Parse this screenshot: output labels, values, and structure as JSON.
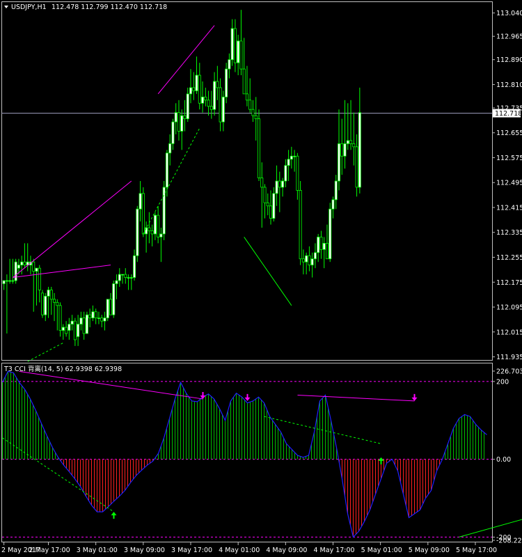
{
  "header": {
    "symbol": "USDJPY,H1",
    "ohlc": "112.478 112.799 112.470 112.718"
  },
  "indicator": {
    "label": "T3 CCI 背离(14, 5) 62.9398 62.9398"
  },
  "colors": {
    "background": "#000000",
    "grid": "#c0c0c0",
    "bull_candle": "#00ff00",
    "bull_body": "#ffffff",
    "bear_candle": "#00ff00",
    "bear_body": "#000000",
    "current_price_line": "#a0a0c0",
    "bear_divergence": "#ff00ff",
    "bull_divergence": "#00ff00",
    "cci_line": "#2020ff",
    "hist_pos": "#00c000",
    "hist_neg": "#ff2020",
    "level_line": "#ff00ff"
  },
  "chart_data": [
    {
      "type": "candlestick",
      "title": "USDJPY,H1",
      "price_axis": {
        "ticks": [
          113.04,
          112.965,
          112.89,
          112.81,
          112.735,
          112.655,
          112.575,
          112.495,
          112.415,
          112.335,
          112.255,
          112.175,
          112.095,
          112.015,
          111.935
        ],
        "tick_labels": [
          "113.040",
          "112.965",
          "112.890",
          "112.810",
          "112.735",
          "112.655",
          "112.575",
          "112.495",
          "112.415",
          "112.335",
          "112.255",
          "112.175",
          "112.095",
          "112.015",
          "111.935"
        ],
        "range": [
          111.925,
          113.075
        ],
        "current_price": 112.718,
        "current_price_label": "112.718"
      },
      "time_axis": {
        "labels": [
          "2 May 2017",
          "2 May 17:00",
          "3 May 01:00",
          "3 May 09:00",
          "3 May 17:00",
          "4 May 01:00",
          "4 May 09:00",
          "4 May 17:00",
          "5 May 01:00",
          "5 May 09:00",
          "5 May 17:00"
        ],
        "label_bar_index": [
          0,
          15,
          31,
          47,
          63,
          79,
          95,
          111,
          127,
          143,
          159
        ]
      },
      "candles": [
        [
          112.17,
          112.18,
          112.15,
          112.18
        ],
        [
          112.18,
          112.2,
          112.01,
          112.18
        ],
        [
          112.18,
          112.25,
          112.17,
          112.18
        ],
        [
          112.18,
          112.25,
          112.17,
          112.18
        ],
        [
          112.18,
          112.25,
          112.17,
          112.24
        ],
        [
          112.22,
          112.25,
          112.2,
          112.23
        ],
        [
          112.23,
          112.26,
          112.2,
          112.24
        ],
        [
          112.24,
          112.3,
          112.22,
          112.23
        ],
        [
          112.23,
          112.3,
          112.21,
          112.24
        ],
        [
          112.23,
          112.26,
          112.2,
          112.24
        ],
        [
          112.24,
          112.25,
          112.08,
          112.21
        ],
        [
          112.21,
          112.22,
          112.1,
          112.22
        ],
        [
          112.22,
          112.23,
          112.11,
          112.15
        ],
        [
          112.14,
          112.15,
          112.06,
          112.07
        ],
        [
          112.07,
          112.14,
          112.05,
          112.13
        ],
        [
          112.13,
          112.16,
          112.06,
          112.15
        ],
        [
          112.15,
          112.16,
          112.07,
          112.12
        ],
        [
          112.12,
          112.14,
          112.05,
          112.11
        ],
        [
          112.11,
          112.12,
          112.02,
          112.1
        ],
        [
          112.1,
          112.11,
          112.0,
          112.02
        ],
        [
          112.02,
          112.04,
          111.99,
          112.03
        ],
        [
          112.03,
          112.05,
          112.0,
          112.01
        ],
        [
          112.02,
          112.06,
          111.99,
          112.04
        ],
        [
          112.04,
          112.07,
          112.02,
          112.05
        ],
        [
          112.05,
          112.06,
          111.97,
          111.99
        ],
        [
          112.0,
          112.07,
          111.97,
          112.04
        ],
        [
          112.04,
          112.08,
          112.02,
          112.06
        ],
        [
          112.06,
          112.08,
          111.99,
          112.01
        ],
        [
          112.01,
          112.08,
          112.01,
          112.07
        ],
        [
          112.07,
          112.09,
          112.03,
          112.06
        ],
        [
          112.06,
          112.1,
          112.05,
          112.08
        ],
        [
          112.08,
          112.09,
          112.04,
          112.06
        ],
        [
          112.06,
          112.08,
          112.04,
          112.06
        ],
        [
          112.06,
          112.07,
          112.03,
          112.05
        ],
        [
          112.05,
          112.08,
          112.02,
          112.06
        ],
        [
          112.06,
          112.12,
          112.05,
          112.12
        ],
        [
          112.12,
          112.14,
          112.08,
          112.07
        ],
        [
          112.07,
          112.18,
          112.06,
          112.17
        ],
        [
          112.17,
          112.2,
          112.12,
          112.18
        ],
        [
          112.18,
          112.22,
          112.16,
          112.2
        ],
        [
          112.2,
          112.2,
          112.17,
          112.2
        ],
        [
          112.2,
          112.22,
          112.17,
          112.19
        ],
        [
          112.19,
          112.2,
          112.15,
          112.19
        ],
        [
          112.19,
          112.2,
          112.15,
          112.19
        ],
        [
          112.19,
          112.28,
          112.18,
          112.26
        ],
        [
          112.26,
          112.42,
          112.24,
          112.41
        ],
        [
          112.41,
          112.5,
          112.37,
          112.46
        ],
        [
          112.46,
          112.48,
          112.32,
          112.33
        ],
        [
          112.33,
          112.37,
          112.27,
          112.35
        ],
        [
          112.35,
          112.4,
          112.3,
          112.34
        ],
        [
          112.34,
          112.36,
          112.29,
          112.33
        ],
        [
          112.33,
          112.4,
          112.31,
          112.39
        ],
        [
          112.39,
          112.42,
          112.3,
          112.32
        ],
        [
          112.32,
          112.35,
          112.24,
          112.33
        ],
        [
          112.33,
          112.5,
          112.31,
          112.48
        ],
        [
          112.48,
          112.6,
          112.45,
          112.59
        ],
        [
          112.59,
          112.65,
          112.55,
          112.62
        ],
        [
          112.62,
          112.7,
          112.6,
          112.69
        ],
        [
          112.69,
          112.75,
          112.65,
          112.72
        ],
        [
          112.72,
          112.76,
          112.63,
          112.66
        ],
        [
          112.66,
          112.73,
          112.6,
          112.71
        ],
        [
          112.71,
          112.76,
          112.66,
          112.7
        ],
        [
          112.7,
          112.8,
          112.69,
          112.78
        ],
        [
          112.78,
          112.86,
          112.75,
          112.8
        ],
        [
          112.8,
          112.85,
          112.76,
          112.79
        ],
        [
          112.79,
          112.9,
          112.78,
          112.84
        ],
        [
          112.84,
          112.88,
          112.73,
          112.75
        ],
        [
          112.75,
          112.82,
          112.72,
          112.77
        ],
        [
          112.77,
          112.8,
          112.74,
          112.76
        ],
        [
          112.76,
          112.79,
          112.71,
          112.74
        ],
        [
          112.74,
          112.79,
          112.7,
          112.73
        ],
        [
          112.73,
          112.85,
          112.71,
          112.82
        ],
        [
          112.82,
          112.87,
          112.76,
          112.8
        ],
        [
          112.8,
          112.83,
          112.66,
          112.69
        ],
        [
          112.69,
          112.79,
          112.66,
          112.77
        ],
        [
          112.77,
          112.88,
          112.75,
          112.86
        ],
        [
          112.86,
          112.91,
          112.83,
          112.89
        ],
        [
          112.89,
          113.02,
          112.87,
          112.99
        ],
        [
          112.99,
          113.02,
          112.85,
          112.88
        ],
        [
          112.88,
          112.97,
          112.84,
          112.95
        ],
        [
          112.95,
          113.05,
          112.84,
          112.86
        ],
        [
          112.86,
          112.96,
          112.78,
          112.78
        ],
        [
          112.78,
          112.87,
          112.74,
          112.76
        ],
        [
          112.76,
          112.83,
          112.72,
          112.73
        ],
        [
          112.73,
          112.76,
          112.69,
          112.71
        ],
        [
          112.71,
          112.77,
          112.63,
          112.7
        ],
        [
          112.7,
          112.73,
          112.5,
          112.51
        ],
        [
          112.51,
          112.56,
          112.35,
          112.48
        ],
        [
          112.48,
          112.49,
          112.38,
          112.43
        ],
        [
          112.43,
          112.46,
          112.39,
          112.42
        ],
        [
          112.42,
          112.47,
          112.36,
          112.38
        ],
        [
          112.38,
          112.48,
          112.37,
          112.46
        ],
        [
          112.46,
          112.55,
          112.42,
          112.5
        ],
        [
          112.5,
          112.53,
          112.4,
          112.48
        ],
        [
          112.48,
          112.51,
          112.45,
          112.5
        ],
        [
          112.5,
          112.57,
          112.48,
          112.55
        ],
        [
          112.55,
          112.6,
          112.5,
          112.57
        ],
        [
          112.57,
          112.61,
          112.54,
          112.58
        ],
        [
          112.58,
          112.6,
          112.53,
          112.58
        ],
        [
          112.58,
          112.59,
          112.44,
          112.47
        ],
        [
          112.47,
          112.5,
          112.23,
          112.25
        ],
        [
          112.25,
          112.28,
          112.2,
          112.24
        ],
        [
          112.24,
          112.27,
          112.2,
          112.26
        ],
        [
          112.26,
          112.29,
          112.21,
          112.23
        ],
        [
          112.23,
          112.27,
          112.19,
          112.25
        ],
        [
          112.25,
          112.3,
          112.22,
          112.27
        ],
        [
          112.27,
          112.33,
          112.24,
          112.32
        ],
        [
          112.32,
          112.34,
          112.25,
          112.28
        ],
        [
          112.28,
          112.32,
          112.22,
          112.3
        ],
        [
          112.3,
          112.36,
          112.28,
          112.25
        ],
        [
          112.25,
          112.43,
          112.24,
          112.41
        ],
        [
          112.41,
          112.45,
          112.38,
          112.44
        ],
        [
          112.44,
          112.52,
          112.41,
          112.5
        ],
        [
          112.5,
          112.73,
          112.47,
          112.62
        ],
        [
          112.62,
          112.7,
          112.52,
          112.58
        ],
        [
          112.58,
          112.76,
          112.54,
          112.62
        ],
        [
          112.62,
          112.75,
          112.6,
          112.63
        ],
        [
          112.63,
          112.76,
          112.6,
          112.62
        ],
        [
          112.62,
          112.72,
          112.55,
          112.61
        ],
        [
          112.61,
          112.65,
          112.45,
          112.48
        ],
        [
          112.48,
          112.8,
          112.46,
          112.72
        ]
      ],
      "annotations": [
        {
          "kind": "bear-divergence-line",
          "color": "magenta",
          "from_bar": 3,
          "from_price": 112.19,
          "to_bar": 43,
          "to_price": 112.5
        },
        {
          "kind": "bear-divergence-line",
          "color": "magenta",
          "from_bar": 3,
          "from_price": 112.19,
          "to_bar": 36,
          "to_price": 112.23
        },
        {
          "kind": "bear-divergence-line",
          "color": "magenta",
          "from_bar": 52,
          "from_price": 112.78,
          "to_bar": 71,
          "to_price": 113.0
        },
        {
          "kind": "bull-divergence-line",
          "color": "green",
          "style": "dashed",
          "from_bar": 8,
          "from_price": 111.92,
          "to_bar": 20,
          "to_price": 111.98
        },
        {
          "kind": "bull-divergence-line",
          "color": "green",
          "style": "dashed",
          "from_bar": 47,
          "from_price": 112.33,
          "to_bar": 66,
          "to_price": 112.67
        },
        {
          "kind": "bull-divergence-line",
          "color": "green",
          "style": "solid",
          "from_bar": 81,
          "from_price": 112.32,
          "to_bar": 97,
          "to_price": 112.1
        }
      ]
    },
    {
      "type": "bar",
      "title": "T3 CCI 背离(14, 5) 62.9398 62.9398",
      "y_axis": {
        "tick_labels": [
          "226.7032",
          "200",
          "0.00",
          "-200",
          "-208.2230"
        ],
        "ticks": [
          226.7032,
          200,
          0,
          -200,
          -208.223
        ],
        "range": [
          -208.223,
          226.7032
        ]
      },
      "levels": [
        200,
        -200
      ],
      "values": [
        198,
        226,
        222,
        198,
        180,
        155,
        125,
        92,
        60,
        30,
        5,
        -15,
        -32,
        -50,
        -70,
        -95,
        -118,
        -135,
        -135,
        -122,
        -108,
        -95,
        -80,
        -60,
        -42,
        -28,
        -15,
        -5,
        15,
        55,
        105,
        155,
        198,
        170,
        150,
        148,
        160,
        168,
        155,
        130,
        100,
        150,
        170,
        160,
        145,
        150,
        160,
        145,
        110,
        90,
        70,
        40,
        25,
        10,
        5,
        10,
        70,
        150,
        165,
        100,
        30,
        -50,
        -140,
        -200,
        -185,
        -160,
        -130,
        -90,
        -50,
        -10,
        0,
        -30,
        -90,
        -150,
        -140,
        -130,
        -100,
        -80,
        -30,
        0,
        40,
        80,
        105,
        115,
        110,
        90,
        75,
        63
      ],
      "series": [
        {
          "name": "T3 CCI",
          "color": "#2020ff",
          "kind": "line"
        }
      ],
      "divergence_arrows": [
        {
          "kind": "up",
          "color": "green",
          "bar": 20,
          "value": -135
        },
        {
          "kind": "down",
          "color": "magenta",
          "bar": 36,
          "value": 155
        },
        {
          "kind": "down",
          "color": "magenta",
          "bar": 44,
          "value": 150
        },
        {
          "kind": "up",
          "color": "green",
          "bar": 68,
          "value": 5
        },
        {
          "kind": "down",
          "color": "magenta",
          "bar": 74,
          "value": 150
        },
        {
          "kind": "up",
          "color": "green",
          "bar": 96,
          "value": -140
        }
      ],
      "divergence_lines": [
        {
          "color": "magenta",
          "style": "solid",
          "from_bar": 3,
          "from_value": 226,
          "to_bar": 36,
          "to_value": 155
        },
        {
          "color": "magenta",
          "style": "solid",
          "from_bar": 53,
          "from_value": 165,
          "to_bar": 74,
          "to_value": 150
        },
        {
          "color": "green",
          "style": "dashed",
          "from_bar": 0,
          "from_value": 55,
          "to_bar": 20,
          "to_value": -135
        },
        {
          "color": "green",
          "style": "dashed",
          "from_bar": 47,
          "from_value": 110,
          "to_bar": 68,
          "to_value": 40
        },
        {
          "color": "green",
          "style": "solid",
          "from_bar": 82,
          "from_value": -200,
          "to_bar": 97,
          "to_value": -140
        }
      ]
    }
  ]
}
